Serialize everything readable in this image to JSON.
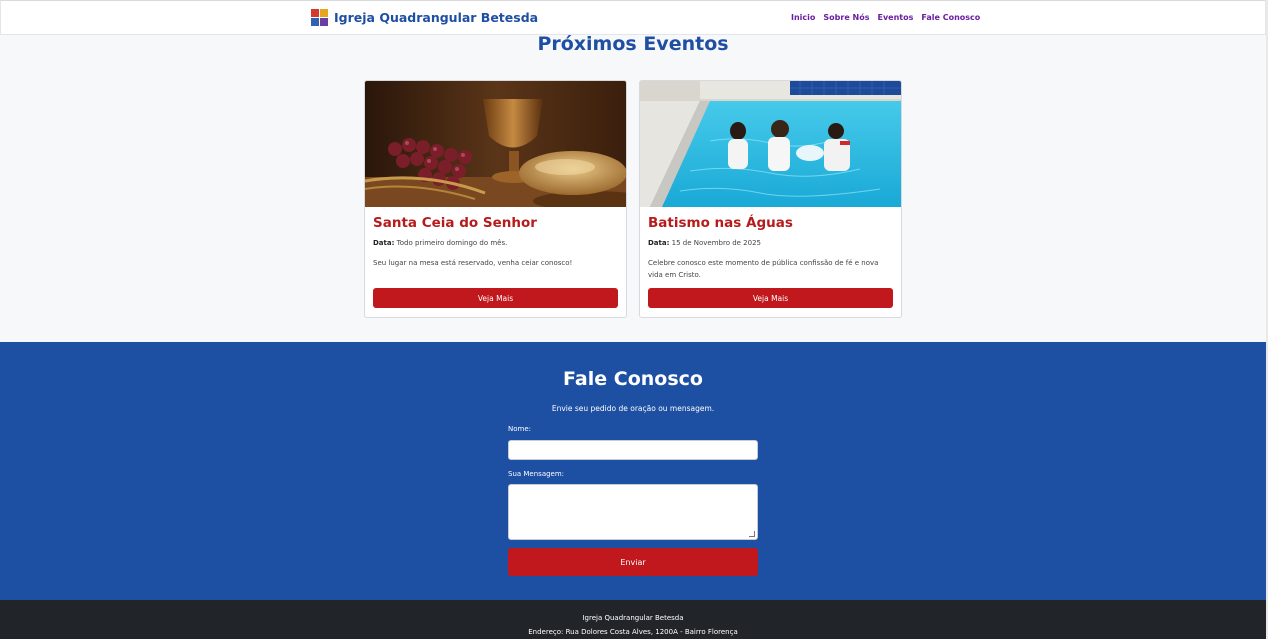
{
  "header": {
    "brand": "Igreja Quadrangular Betesda",
    "nav": [
      "Inicio",
      "Sobre Nós",
      "Eventos",
      "Fale Conosco"
    ]
  },
  "events": {
    "title": "Próximos Eventos",
    "cards": [
      {
        "title": "Santa Ceia do Senhor",
        "date_label": "Data:",
        "date_value": "Todo primeiro domingo do mês.",
        "description": "Seu lugar na mesa está reservado, venha ceiar conosco!",
        "button": "Veja Mais"
      },
      {
        "title": "Batismo nas Águas",
        "date_label": "Data:",
        "date_value": "15 de Novembro de 2025",
        "description": "Celebre conosco este momento de pública confissão de fé e nova vida em Cristo.",
        "button": "Veja Mais"
      }
    ]
  },
  "contact": {
    "title": "Fale Conosco",
    "subtitle": "Envie seu pedido de oração ou mensagem.",
    "name_label": "Nome:",
    "message_label": "Sua Mensagem:",
    "submit": "Enviar"
  },
  "footer": {
    "line1": "Igreja Quadrangular Betesda",
    "line2": "Endereço: Rua Dolores Costa Alves, 1200A - Bairro Florença"
  },
  "colors": {
    "brand_blue": "#1f4fa3",
    "accent_red": "#c0181c",
    "nav_purple": "#6a1fa0",
    "footer_dark": "#212529"
  }
}
